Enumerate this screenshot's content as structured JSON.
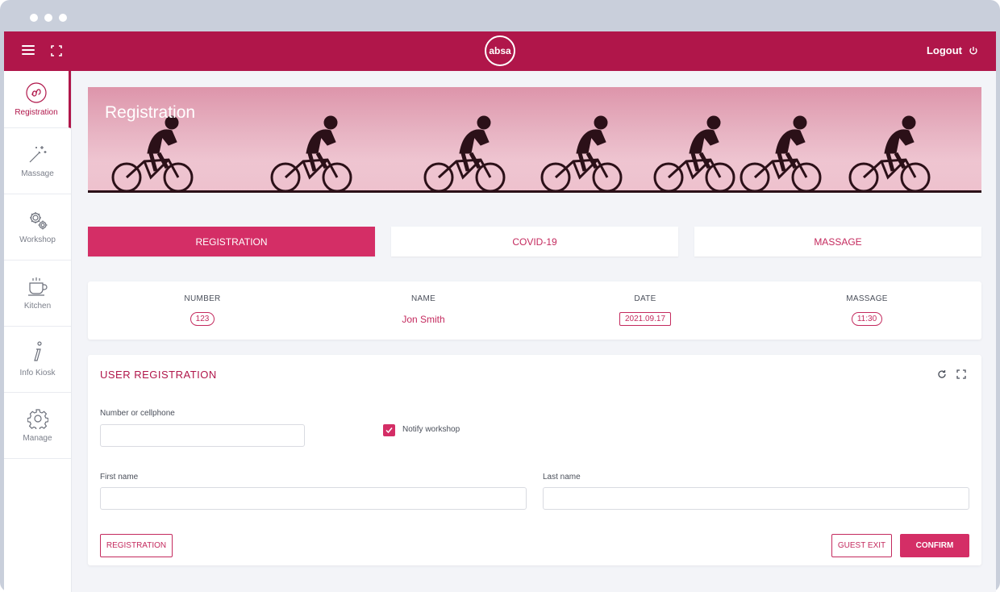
{
  "app": {
    "logo_text": "absa",
    "logout_label": "Logout"
  },
  "sidebar": {
    "items": [
      {
        "label": "Registration",
        "icon": "registration-icon",
        "active": true
      },
      {
        "label": "Massage",
        "icon": "magic-wand-icon",
        "active": false
      },
      {
        "label": "Workshop",
        "icon": "gears-icon",
        "active": false
      },
      {
        "label": "Kitchen",
        "icon": "coffee-cup-icon",
        "active": false
      },
      {
        "label": "Info Kiosk",
        "icon": "info-icon",
        "active": false
      },
      {
        "label": "Manage",
        "icon": "gear-icon",
        "active": false
      }
    ]
  },
  "banner": {
    "title": "Registration"
  },
  "tabs": [
    {
      "label": "REGISTRATION",
      "active": true
    },
    {
      "label": "COVID-19",
      "active": false
    },
    {
      "label": "MASSAGE",
      "active": false
    }
  ],
  "info": {
    "number_label": "NUMBER",
    "number_value": "123",
    "name_label": "NAME",
    "name_value": "Jon Smith",
    "date_label": "DATE",
    "date_value": "2021.09.17",
    "massage_label": "MASSAGE",
    "massage_value": "11:30"
  },
  "form": {
    "title": "USER REGISTRATION",
    "number_label": "Number or cellphone",
    "number_value": "",
    "notify_label": "Notify workshop",
    "notify_checked": true,
    "first_name_label": "First name",
    "first_name_value": "",
    "last_name_label": "Last name",
    "last_name_value": "",
    "registration_button": "REGISTRATION",
    "guest_exit_button": "GUEST EXIT",
    "confirm_button": "CONFIRM"
  },
  "colors": {
    "brand": "#b0164a",
    "accent": "#d42e66",
    "background": "#f3f4f8"
  }
}
